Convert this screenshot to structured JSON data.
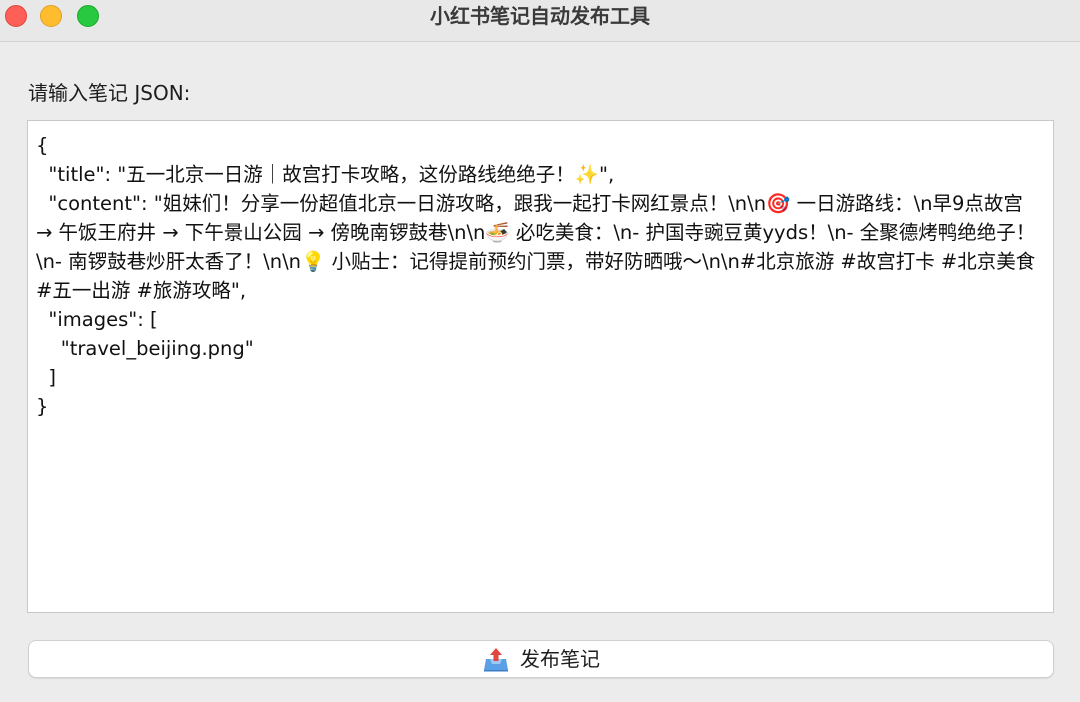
{
  "window": {
    "title": "小红书笔记自动发布工具"
  },
  "form": {
    "prompt_label": "请输入笔记 JSON:",
    "json_text": "{\n  \"title\": \"五一北京一日游｜故宫打卡攻略，这份路线绝绝子！✨\",\n  \"content\": \"姐妹们！分享一份超值北京一日游攻略，跟我一起打卡网红景点！\\n\\n🎯 一日游路线：\\n早9点故宫 → 午饭王府井 → 下午景山公园 → 傍晚南锣鼓巷\\n\\n🍜 必吃美食：\\n- 护国寺豌豆黄yyds！\\n- 全聚德烤鸭绝绝子！\\n- 南锣鼓巷炒肝太香了！\\n\\n💡 小贴士：记得提前预约门票，带好防晒哦～\\n\\n#北京旅游 #故宫打卡 #北京美食 #五一出游 #旅游攻略\",\n  \"images\": [\n    \"travel_beijing.png\"\n  ]\n}"
  },
  "actions": {
    "publish_label": "发布笔记",
    "publish_icon": "outbox-tray-icon"
  },
  "colors": {
    "close": "#fe5f57",
    "minimize": "#febc2e",
    "maximize": "#28c840"
  }
}
